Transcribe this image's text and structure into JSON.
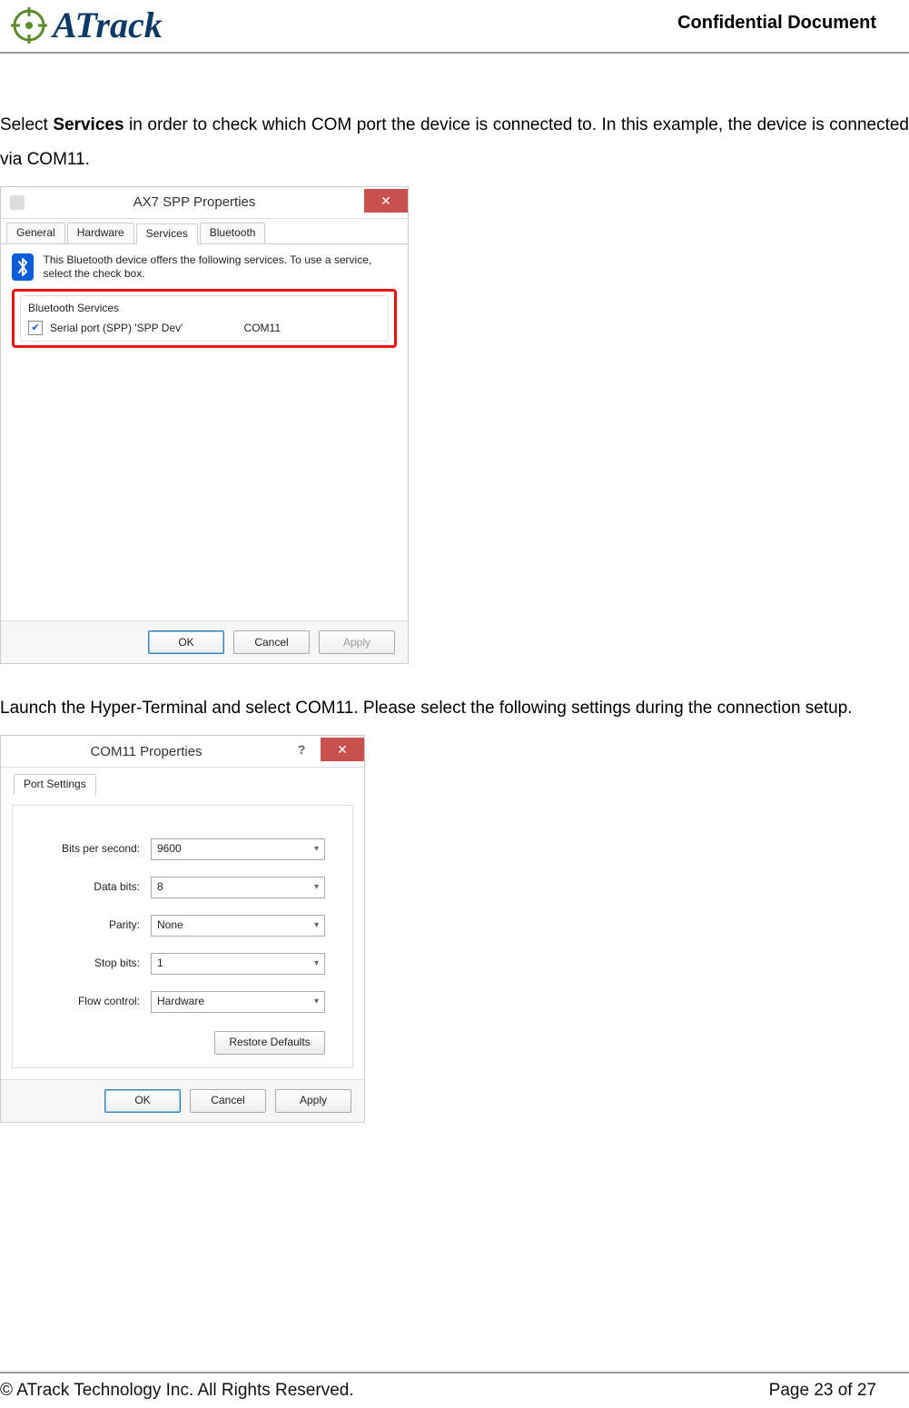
{
  "header": {
    "brand": "ATrack",
    "confidential": "Confidential  Document"
  },
  "para1_pre": "Select ",
  "para1_bold": "Services",
  "para1_post": " in order to check which COM port the device is connected to. In this example, the device is connected via COM11.",
  "dlg1": {
    "title": "AX7 SPP Properties",
    "tabs": [
      "General",
      "Hardware",
      "Services",
      "Bluetooth"
    ],
    "intro": "This Bluetooth device offers the following services. To use a service, select the check box.",
    "group_title": "Bluetooth Services",
    "service_name": "Serial port (SPP) 'SPP Dev'",
    "service_com": "COM11",
    "ok": "OK",
    "cancel": "Cancel",
    "apply": "Apply"
  },
  "para2": "Launch the Hyper-Terminal and select COM11. Please select the following settings during the connection setup.",
  "dlg2": {
    "title": "COM11 Properties",
    "tab": "Port Settings",
    "fields": [
      {
        "label": "Bits per second:",
        "value": "9600"
      },
      {
        "label": "Data bits:",
        "value": "8"
      },
      {
        "label": "Parity:",
        "value": "None"
      },
      {
        "label": "Stop bits:",
        "value": "1"
      },
      {
        "label": "Flow control:",
        "value": "Hardware"
      }
    ],
    "restore": "Restore Defaults",
    "ok": "OK",
    "cancel": "Cancel",
    "apply": "Apply"
  },
  "footer": {
    "copyright": "© ATrack Technology Inc. All Rights Reserved.",
    "page": "Page 23 of 27"
  }
}
